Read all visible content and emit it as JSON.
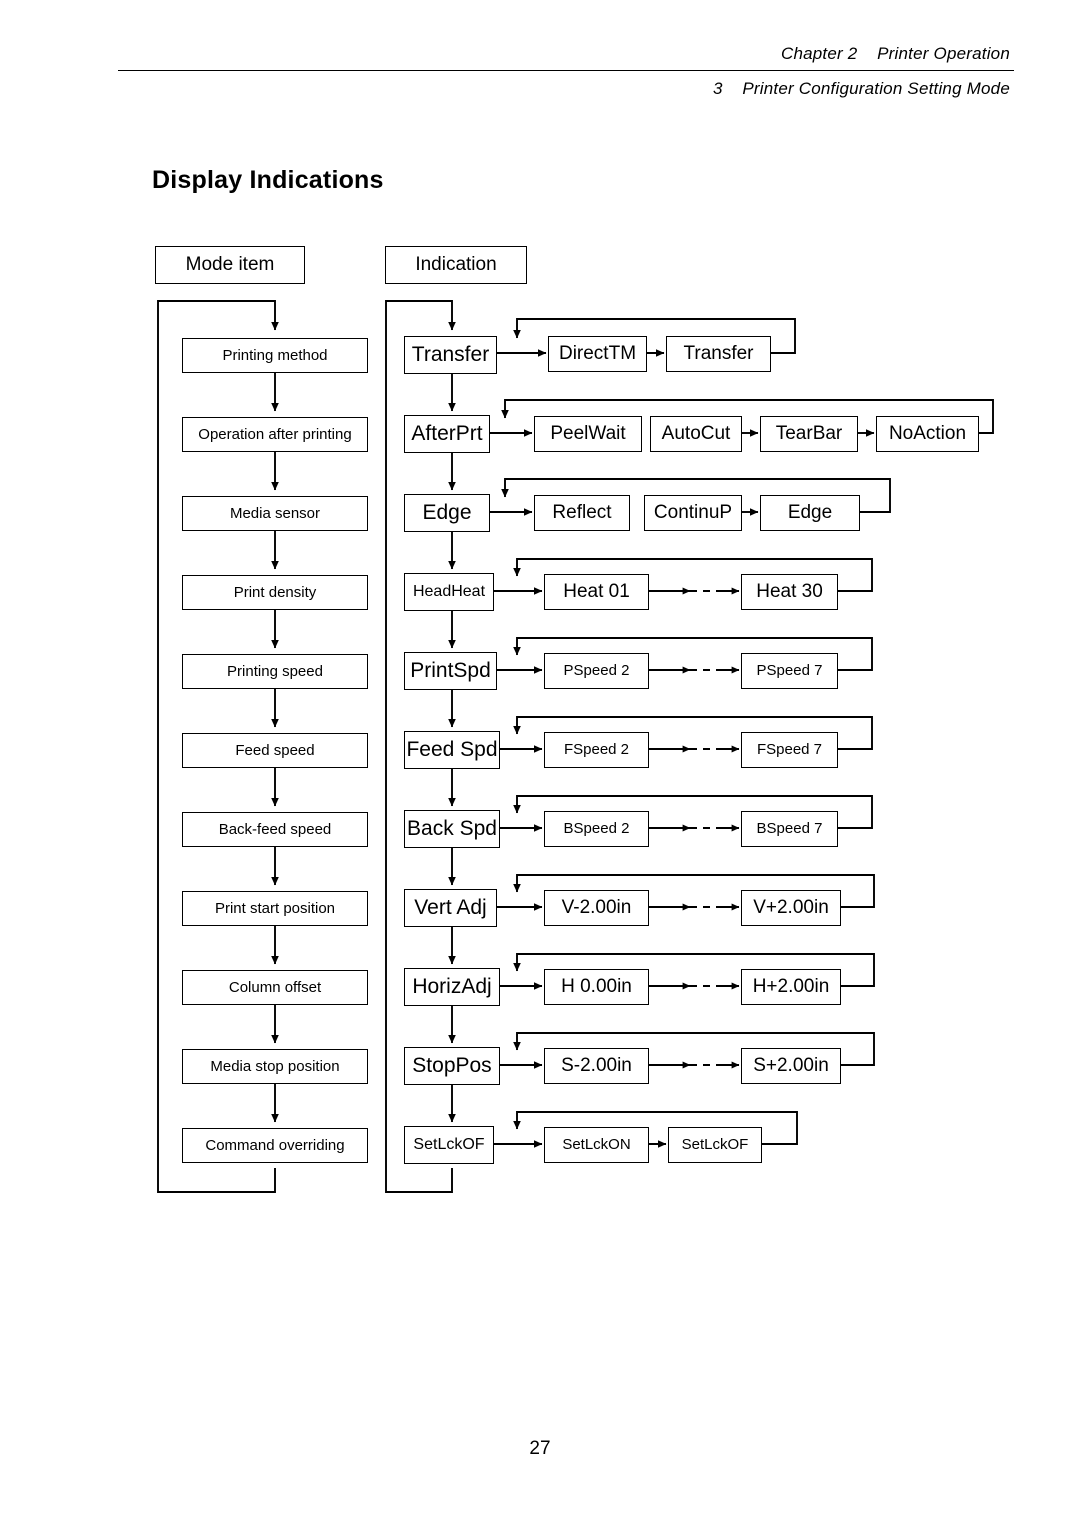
{
  "header": {
    "line1": "Chapter 2    Printer Operation",
    "line2": "3    Printer Configuration Setting Mode"
  },
  "section_title": "Display Indications",
  "page_number": "27",
  "columns": {
    "mode_header": "Mode item",
    "indication_header": "Indication"
  },
  "mode_items": [
    {
      "label": "Printing method"
    },
    {
      "label": "Operation after printing"
    },
    {
      "label": "Media sensor"
    },
    {
      "label": "Print density"
    },
    {
      "label": "Printing speed"
    },
    {
      "label": "Feed speed"
    },
    {
      "label": "Back-feed speed"
    },
    {
      "label": "Print start position"
    },
    {
      "label": "Column offset"
    },
    {
      "label": "Media stop position"
    },
    {
      "label": "Command overriding"
    }
  ],
  "indications": [
    {
      "current": "Transfer",
      "values": [
        "DirectTM",
        "Transfer"
      ],
      "connectors": [
        "solid"
      ],
      "style": "large"
    },
    {
      "current": "AfterPrt",
      "values": [
        "PeelWait",
        "AutoCut",
        "TearBar",
        "NoAction"
      ],
      "connectors": [
        "none",
        "solid",
        "solid"
      ],
      "style": "large"
    },
    {
      "current": "Edge",
      "values": [
        "Reflect",
        "ContinuP",
        "Edge"
      ],
      "connectors": [
        "none",
        "solid"
      ],
      "style": "large"
    },
    {
      "current": "HeadHeat",
      "values": [
        "Heat 01",
        "Heat 30"
      ],
      "connectors": [
        "dashed"
      ],
      "style": "small"
    },
    {
      "current": "PrintSpd",
      "values": [
        "PSpeed 2",
        "PSpeed 7"
      ],
      "connectors": [
        "dashed"
      ],
      "style": "small"
    },
    {
      "current": "Feed Spd",
      "values": [
        "FSpeed 2",
        "FSpeed 7"
      ],
      "connectors": [
        "dashed"
      ],
      "style": "small"
    },
    {
      "current": "Back Spd",
      "values": [
        "BSpeed 2",
        "BSpeed 7"
      ],
      "connectors": [
        "dashed"
      ],
      "style": "small"
    },
    {
      "current": "Vert Adj",
      "values": [
        "V-2.00in",
        "V+2.00in"
      ],
      "connectors": [
        "dashed"
      ],
      "style": "large"
    },
    {
      "current": "HorizAdj",
      "values": [
        "H 0.00in",
        "H+2.00in"
      ],
      "connectors": [
        "dashed"
      ],
      "style": "large"
    },
    {
      "current": "StopPos",
      "values": [
        "S-2.00in",
        "S+2.00in"
      ],
      "connectors": [
        "dashed"
      ],
      "style": "large"
    },
    {
      "current": "SetLckOF",
      "values": [
        "SetLckON",
        "SetLckOF"
      ],
      "connectors": [
        "solid"
      ],
      "style": "small"
    }
  ],
  "colors": {
    "ink": "#000000",
    "paper": "#ffffff"
  }
}
